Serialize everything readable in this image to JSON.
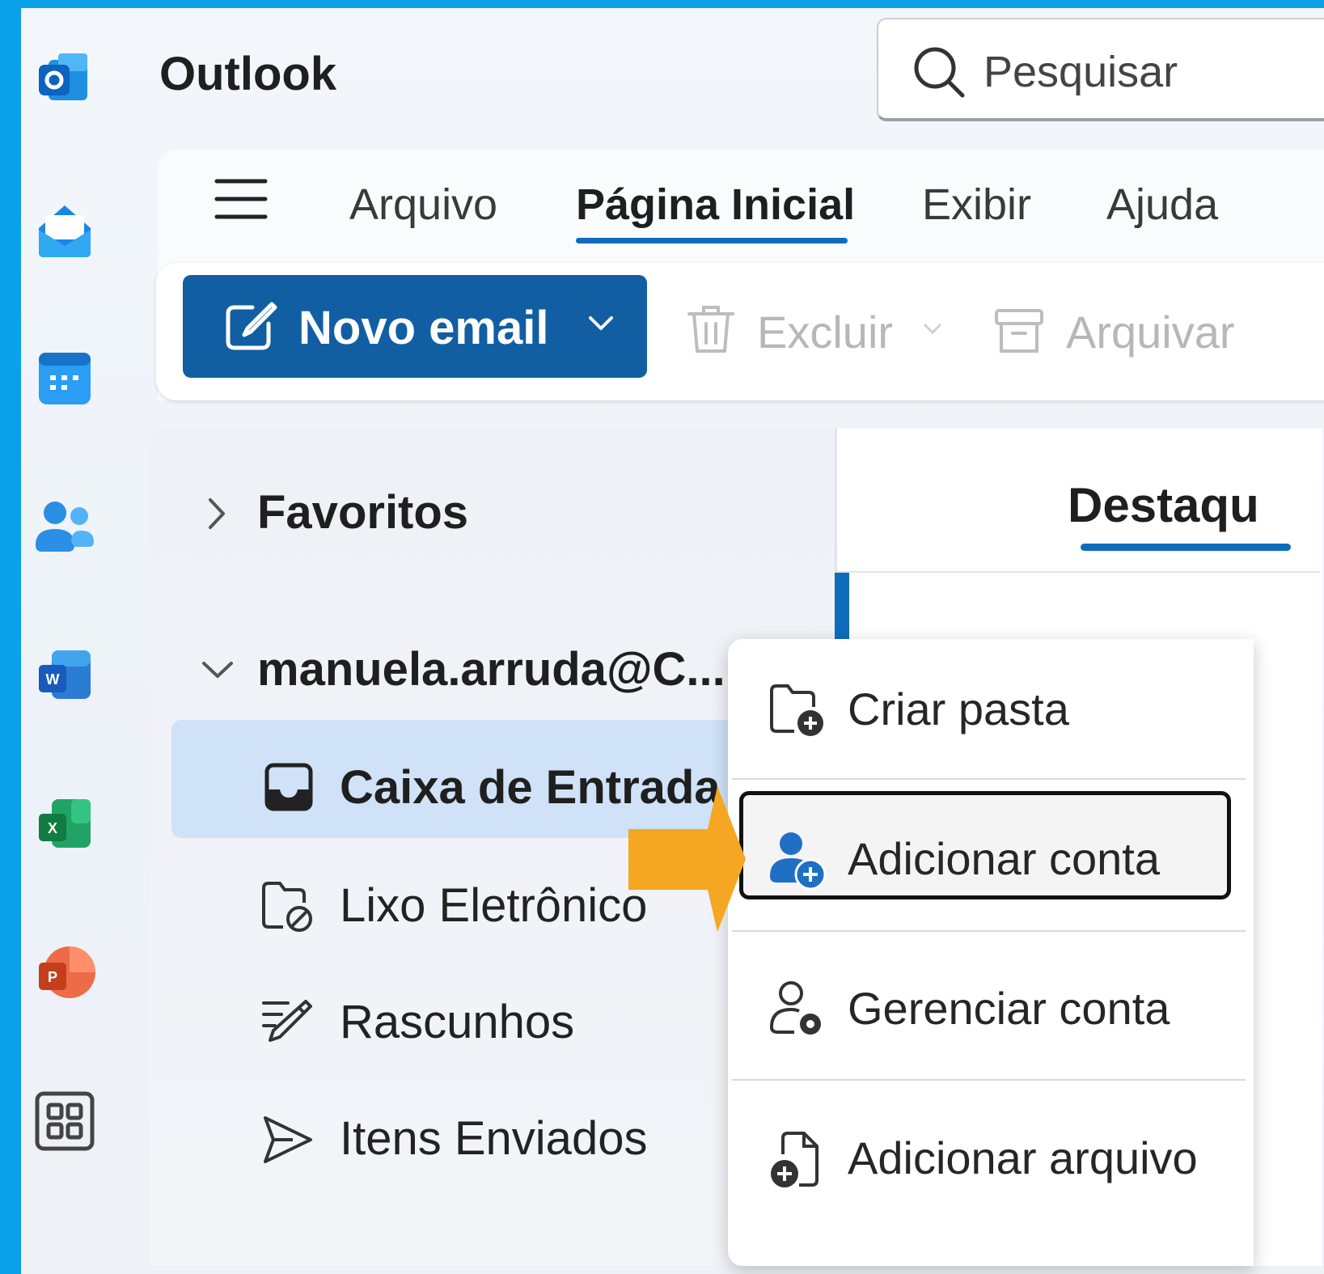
{
  "app": {
    "title": "Outlook"
  },
  "colors": {
    "accent": "#0f6cbd",
    "primary_button": "#115ea3",
    "highlight_arrow": "#f5a623",
    "selection": "#cfe2f7",
    "frame": "#0aa0ea"
  },
  "rail": [
    {
      "name": "outlook-logo-icon"
    },
    {
      "name": "mail-icon"
    },
    {
      "name": "calendar-icon"
    },
    {
      "name": "people-icon"
    },
    {
      "name": "word-icon"
    },
    {
      "name": "excel-icon"
    },
    {
      "name": "powerpoint-icon"
    },
    {
      "name": "apps-icon"
    }
  ],
  "search": {
    "placeholder": "Pesquisar"
  },
  "ribbon": {
    "tabs": [
      "Arquivo",
      "Página Inicial",
      "Exibir",
      "Ajuda"
    ],
    "active_tab": "Página Inicial",
    "new_email_label": "Novo email",
    "delete_label": "Excluir",
    "archive_label": "Arquivar"
  },
  "folders": {
    "favorites_label": "Favoritos",
    "account_label": "manuela.arruda@C...",
    "items": [
      {
        "label": "Caixa de Entrada",
        "icon": "inbox-icon",
        "selected": true
      },
      {
        "label": "Lixo Eletrônico",
        "icon": "junk-icon"
      },
      {
        "label": "Rascunhos",
        "icon": "drafts-icon"
      },
      {
        "label": "Itens Enviados",
        "icon": "sent-icon"
      }
    ]
  },
  "message_list": {
    "tab_label": "Destaqu"
  },
  "context_menu": {
    "items": [
      {
        "label": "Criar pasta",
        "icon": "folder-add-icon"
      },
      {
        "label": "Adicionar conta",
        "icon": "person-add-icon",
        "focused": true
      },
      {
        "label": "Gerenciar conta",
        "icon": "person-settings-icon"
      },
      {
        "label": "Adicionar arquivo",
        "icon": "document-add-icon"
      }
    ]
  }
}
